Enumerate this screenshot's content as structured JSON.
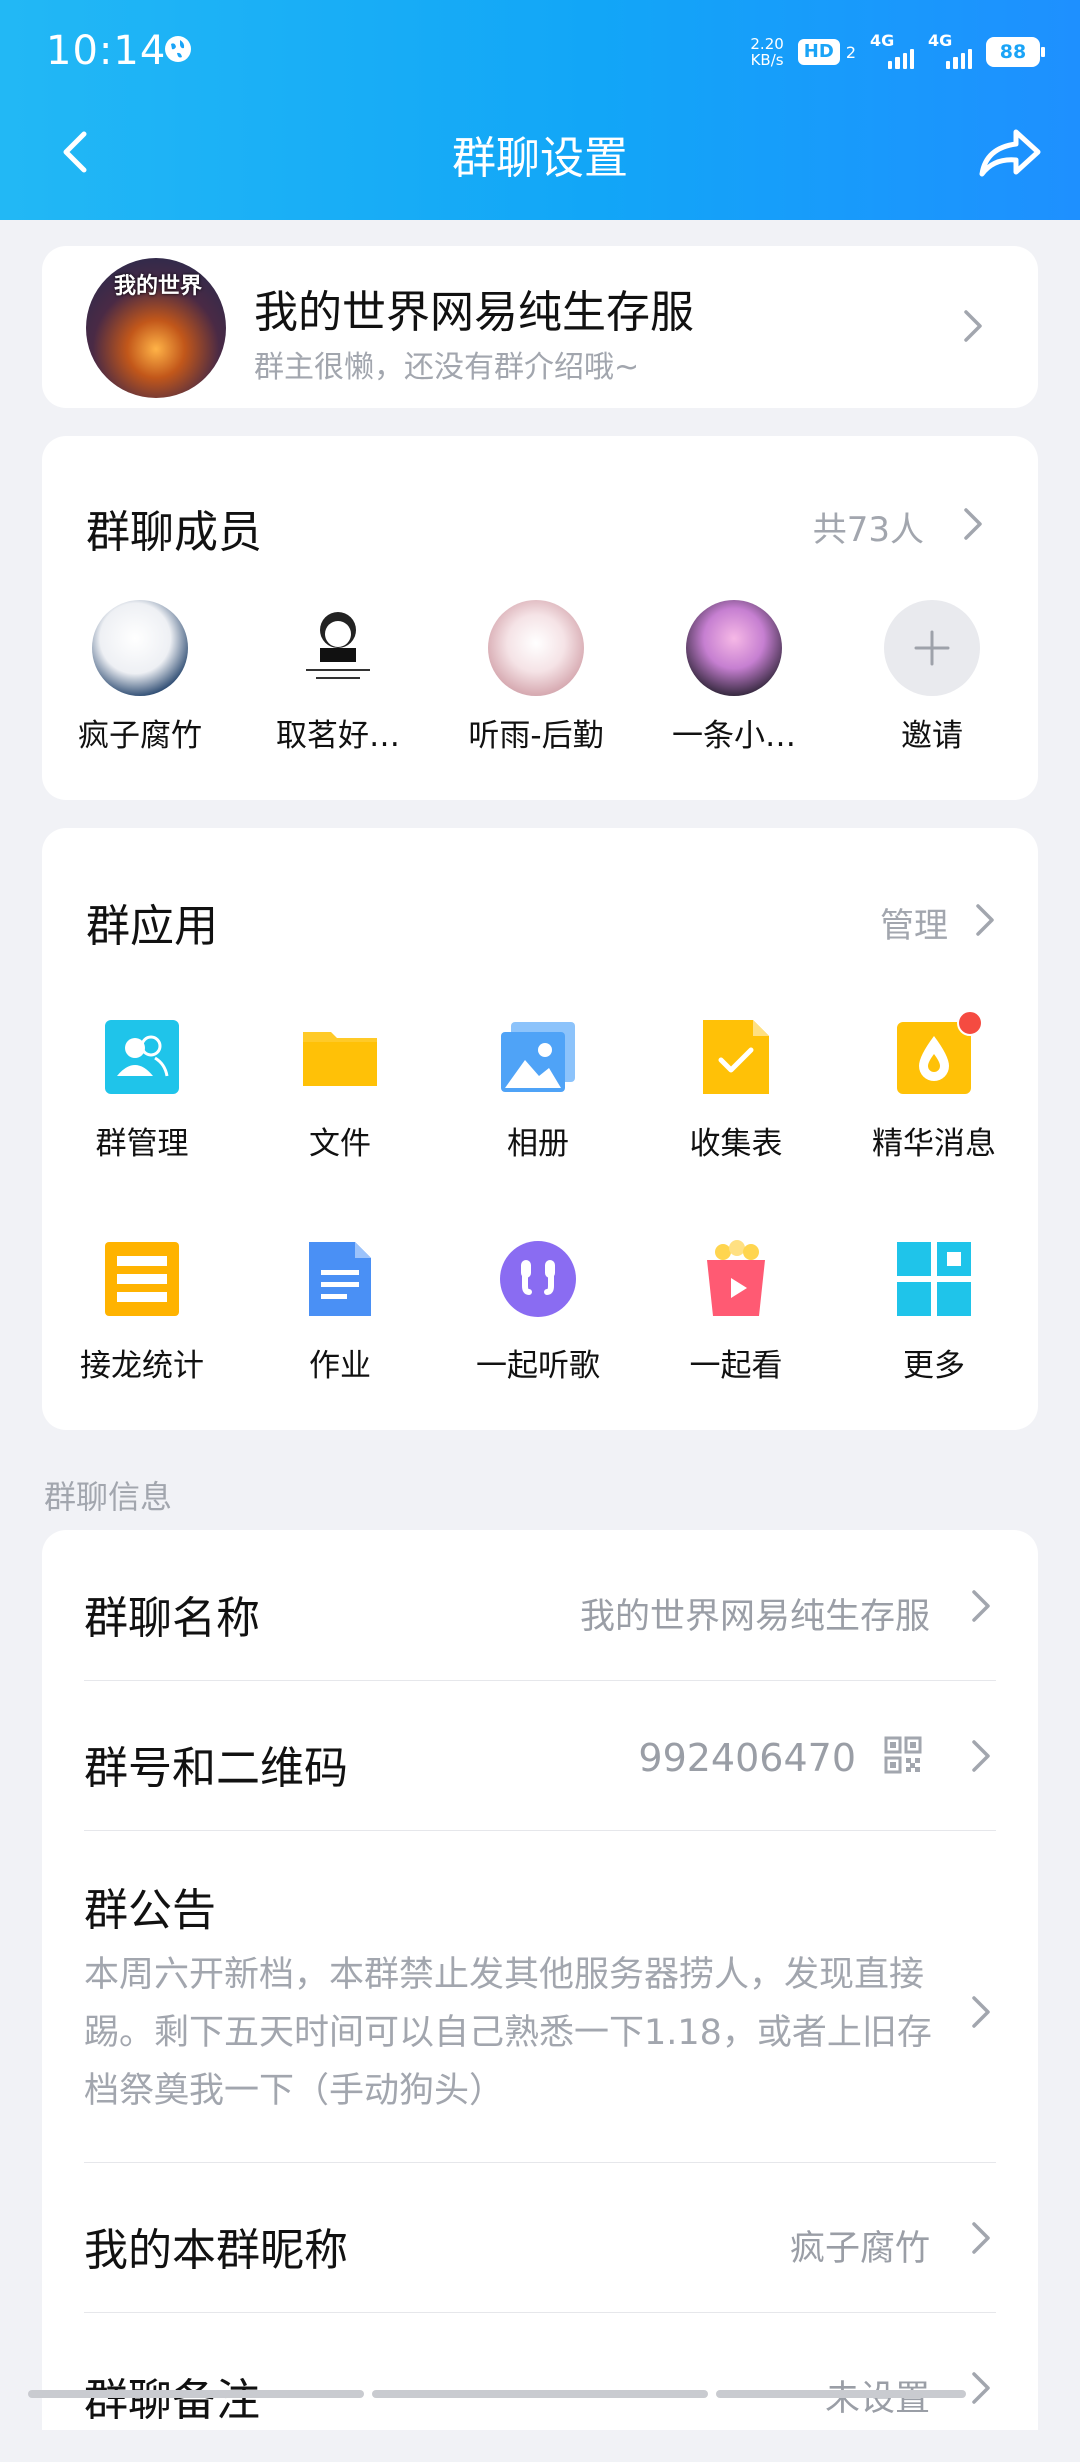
{
  "status_bar": {
    "time": "10:14",
    "net_speed_value": "2.20",
    "net_speed_unit": "KB/s",
    "hd_label": "HD",
    "hd_sub": "2",
    "signal1_label": "4G",
    "signal2_label": "4G",
    "battery": "88"
  },
  "nav": {
    "title": "群聊设置"
  },
  "group": {
    "name": "我的世界网易纯生存服",
    "description": "群主很懒，还没有群介绍哦~",
    "avatar_text": "我的世界"
  },
  "members": {
    "title": "群聊成员",
    "count": "共73人",
    "list": [
      {
        "name": "疯子腐竹"
      },
      {
        "name": "取茗好…"
      },
      {
        "name": "听雨-后勤"
      },
      {
        "name": "一条小…"
      }
    ],
    "invite_label": "邀请"
  },
  "apps": {
    "title": "群应用",
    "manage_label": "管理",
    "items": [
      {
        "label": "群管理",
        "icon": "group-manage-icon",
        "color": "#1fc4ea"
      },
      {
        "label": "文件",
        "icon": "folder-icon",
        "color": "#ffc107"
      },
      {
        "label": "相册",
        "icon": "photo-album-icon",
        "color": "#4fa3f7"
      },
      {
        "label": "收集表",
        "icon": "collect-form-icon",
        "color": "#ffc107"
      },
      {
        "label": "精华消息",
        "icon": "essence-icon",
        "color": "#ffc107",
        "badge": true
      },
      {
        "label": "接龙统计",
        "icon": "relay-stats-icon",
        "color": "#ffb300"
      },
      {
        "label": "作业",
        "icon": "homework-icon",
        "color": "#4a90f5"
      },
      {
        "label": "一起听歌",
        "icon": "listen-together-icon",
        "color": "#8a6cf2"
      },
      {
        "label": "一起看",
        "icon": "watch-together-icon",
        "color": "#ff5a73"
      },
      {
        "label": "更多",
        "icon": "more-apps-icon",
        "color": "#1fc4ea"
      }
    ]
  },
  "info": {
    "section_label": "群聊信息",
    "group_name_title": "群聊名称",
    "group_name_value": "我的世界网易纯生存服",
    "group_id_title": "群号和二维码",
    "group_id_value": "992406470",
    "notice_title": "群公告",
    "notice_text": "本周六开新档，本群禁止发其他服务器捞人，发现直接踢。剩下五天时间可以自己熟悉一下1.18，或者上旧存档祭奠我一下（手动狗头）",
    "nickname_title": "我的本群昵称",
    "nickname_value": "疯子腐竹",
    "remark_title": "群聊备注",
    "remark_value": "未设置"
  }
}
